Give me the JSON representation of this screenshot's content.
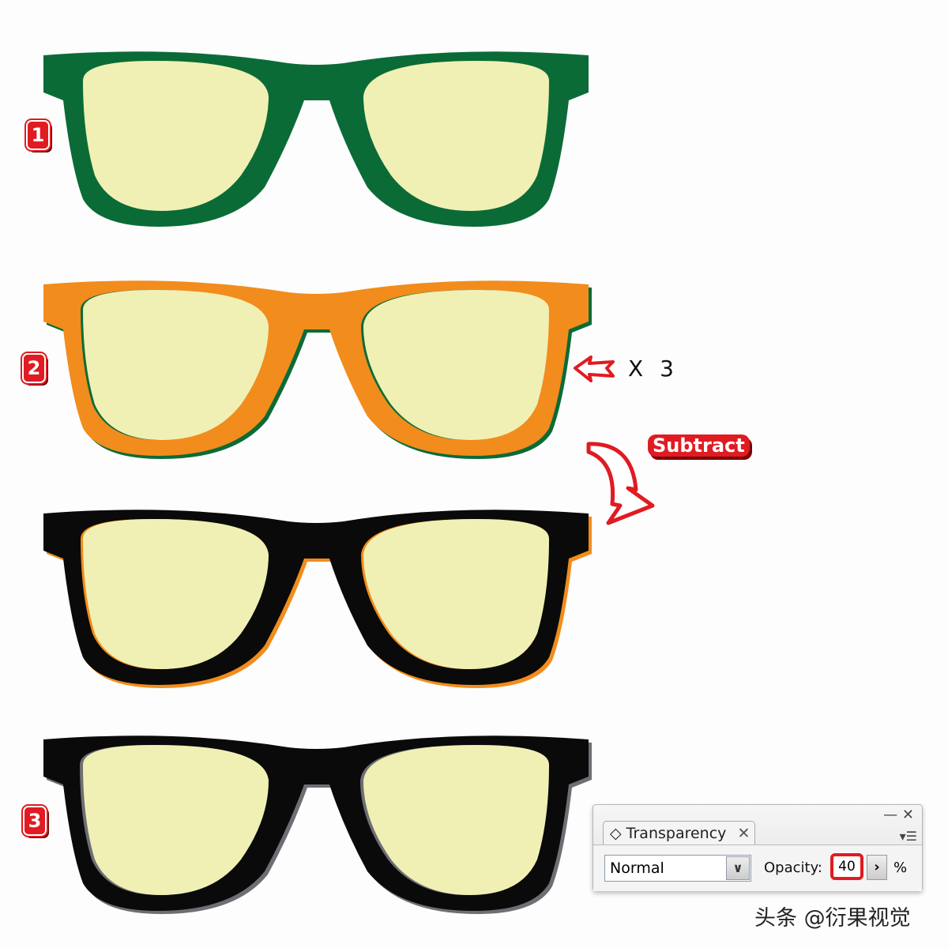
{
  "steps": [
    {
      "label": "1"
    },
    {
      "label": "2"
    },
    {
      "label": "3"
    }
  ],
  "annotations": {
    "repeat": "X 3",
    "subtract": "Subtract"
  },
  "colors": {
    "green": "#0b6b37",
    "orange": "#f28c1c",
    "black": "#0a0a0a",
    "lens": "#f0f0b4",
    "accent": "#e01b22",
    "shadow": "#6e6e74"
  },
  "panel": {
    "tab_icon": "diamond-icon",
    "tab_label": "Transparency",
    "blend_mode": "Normal",
    "opacity_label": "Opacity:",
    "opacity_value": "40",
    "opacity_unit": "%"
  },
  "watermark": "头条 @衍果视觉"
}
